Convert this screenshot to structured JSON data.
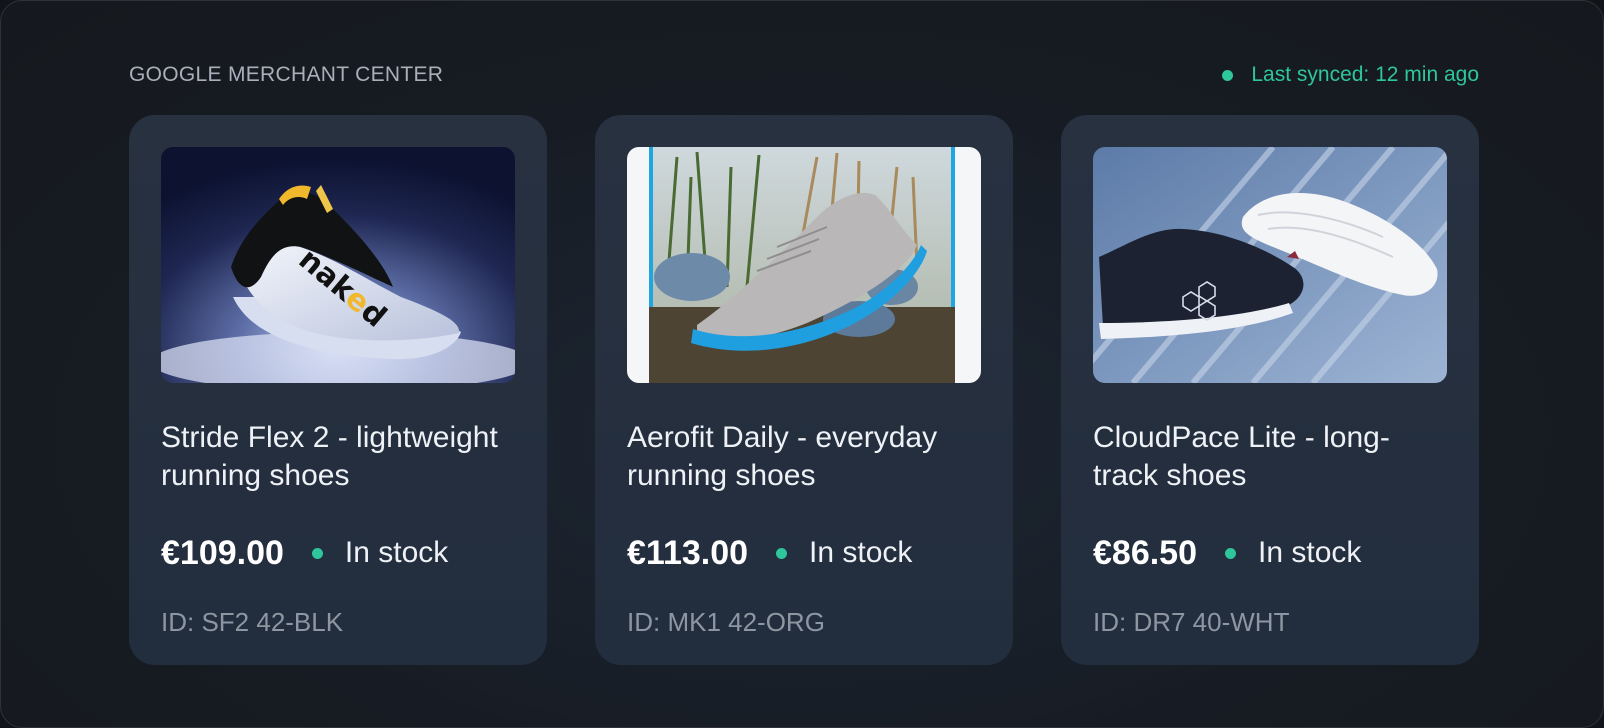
{
  "header": {
    "brand": "GOOGLE MERCHANT CENTER",
    "sync_status": "Last synced: 12 min ago",
    "sync_color": "#2ec69b"
  },
  "products": [
    {
      "title": "Stride Flex 2 - lightweight running shoes",
      "price": "€109.00",
      "availability": "In stock",
      "id_label": "ID: SF2 42-BLK",
      "image_brand_text": "naked"
    },
    {
      "title": "Aerofit Daily - everyday running shoes",
      "price": "€113.00",
      "availability": "In stock",
      "id_label": "ID: MK1 42-ORG"
    },
    {
      "title": "CloudPace Lite - long-track shoes",
      "price": "€86.50",
      "availability": "In stock",
      "id_label": "ID: DR7 40-WHT"
    }
  ],
  "colors": {
    "accent_green": "#2ec69b",
    "card_bg": "#263041",
    "panel_bg": "#171c24"
  }
}
